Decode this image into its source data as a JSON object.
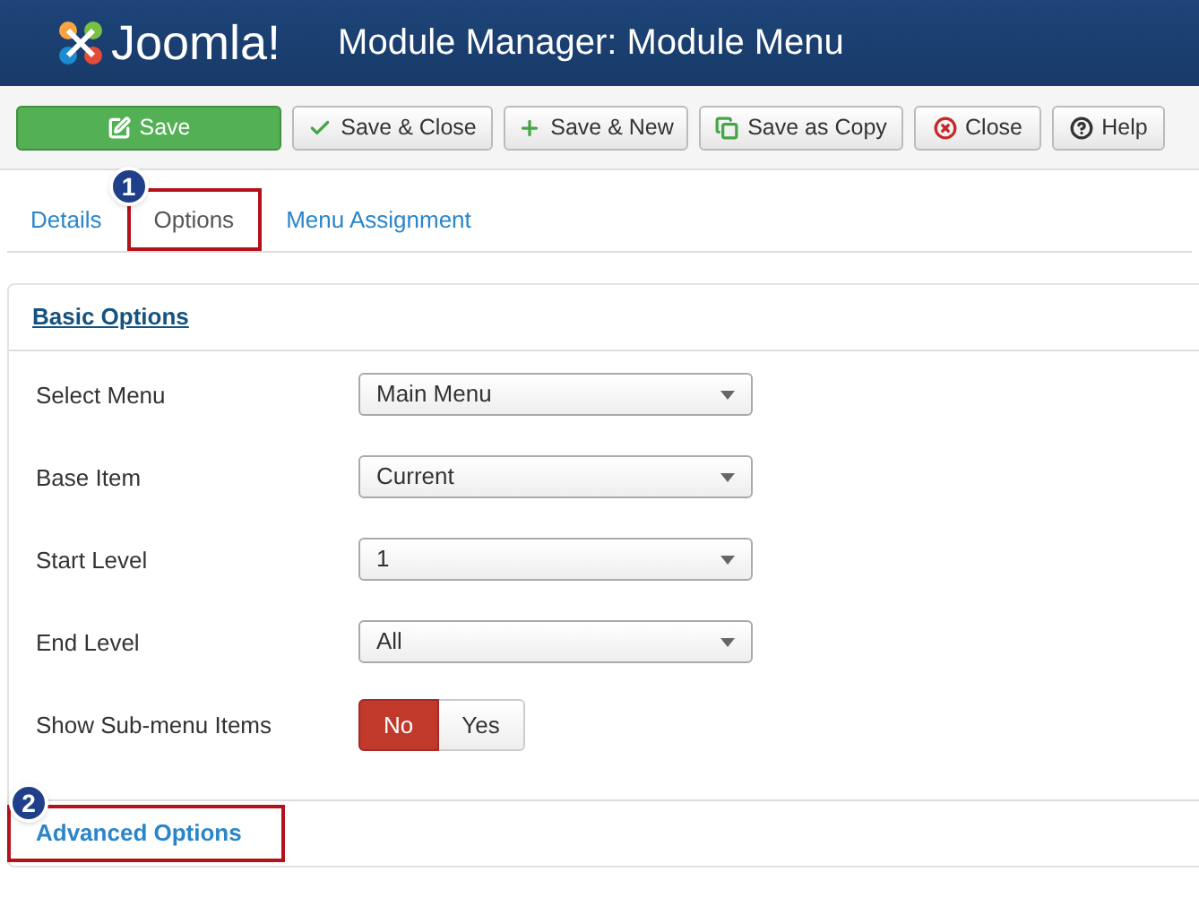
{
  "header": {
    "logo_text": "Joomla!",
    "title": "Module Manager: Module Menu"
  },
  "toolbar": [
    {
      "label": "Save",
      "kind": "primary"
    },
    {
      "label": "Save & Close",
      "kind": "default"
    },
    {
      "label": "Save & New",
      "kind": "default"
    },
    {
      "label": "Save as Copy",
      "kind": "default"
    },
    {
      "label": "Close",
      "kind": "default"
    },
    {
      "label": "Help",
      "kind": "default"
    }
  ],
  "tabs": [
    {
      "label": "Details",
      "selected": false,
      "highlighted": false
    },
    {
      "label": "Options",
      "selected": true,
      "highlighted": true,
      "callout": "1"
    },
    {
      "label": "Menu Assignment",
      "selected": false,
      "highlighted": false
    }
  ],
  "sections": [
    {
      "title": "Basic Options",
      "expanded": true,
      "highlighted": false,
      "fields": [
        {
          "label": "Select Menu",
          "kind": "select",
          "value": "Main Menu"
        },
        {
          "label": "Base Item",
          "kind": "select",
          "value": "Current"
        },
        {
          "label": "Start Level",
          "kind": "select",
          "value": "1"
        },
        {
          "label": "End Level",
          "kind": "select",
          "value": "All"
        },
        {
          "label": "Show Sub-menu Items",
          "kind": "toggle",
          "options": [
            {
              "label": "No",
              "selected": true
            },
            {
              "label": "Yes",
              "selected": false
            }
          ]
        }
      ]
    },
    {
      "title": "Advanced Options",
      "expanded": false,
      "highlighted": true,
      "callout": "2"
    }
  ]
}
